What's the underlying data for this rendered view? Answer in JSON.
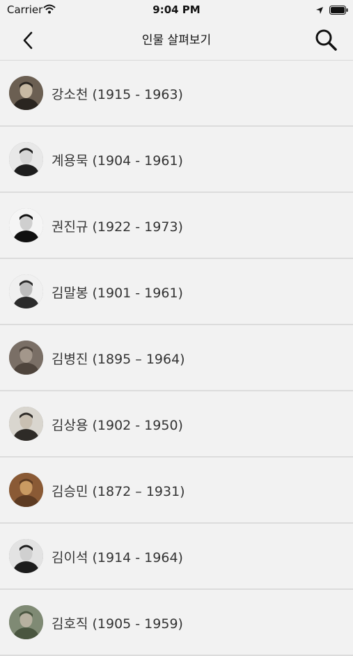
{
  "status_bar": {
    "carrier": "Carrier",
    "time": "9:04 PM"
  },
  "nav": {
    "title": "인물 살펴보기",
    "back_icon": "chevron-left-icon",
    "search_icon": "search-icon"
  },
  "people": [
    {
      "name": "강소천 (1915 - 1963)",
      "bg": "#6b5f52",
      "fg": "#2a2520",
      "face": "#c7b9a3"
    },
    {
      "name": "계용묵 (1904 - 1961)",
      "bg": "#e8e8e8",
      "fg": "#1e1e1e",
      "face": "#d6d6d6"
    },
    {
      "name": "권진규 (1922 - 1973)",
      "bg": "#f5f5f5",
      "fg": "#101010",
      "face": "#cfcfcf"
    },
    {
      "name": "김말봉 (1901 - 1961)",
      "bg": "#f0f0f0",
      "fg": "#2b2b2b",
      "face": "#bdbdbd"
    },
    {
      "name": "김병진 (1895 – 1964)",
      "bg": "#7a6f66",
      "fg": "#4e443c",
      "face": "#a3978b"
    },
    {
      "name": "김상용 (1902 - 1950)",
      "bg": "#d9d6cf",
      "fg": "#2e2b27",
      "face": "#c9c0b2"
    },
    {
      "name": "김승민 (1872 – 1931)",
      "bg": "#8a5a35",
      "fg": "#5d3b22",
      "face": "#c99a62"
    },
    {
      "name": "김이석 (1914 - 1964)",
      "bg": "#e3e3e3",
      "fg": "#1c1c1c",
      "face": "#d0d0d0"
    },
    {
      "name": "김호직 (1905 - 1959)",
      "bg": "#7f8a74",
      "fg": "#4a5640",
      "face": "#b7b1a0"
    }
  ]
}
